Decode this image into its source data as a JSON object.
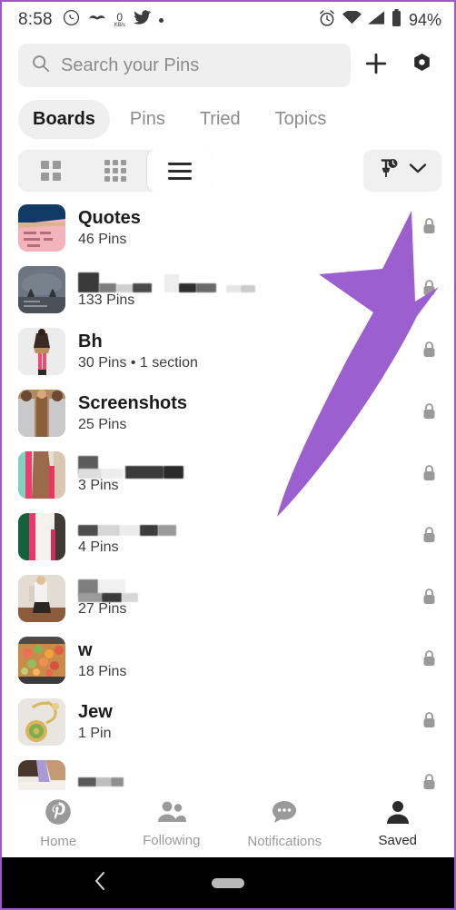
{
  "status_bar": {
    "time": "8:58",
    "left_icons": [
      "whatsapp-icon",
      "mustache-icon",
      "data-speed-icon",
      "twitter-icon",
      "dot-icon"
    ],
    "data_speed_value": "0",
    "data_speed_unit": "KB/s",
    "right_icons": [
      "alarm-clock-icon",
      "wifi-icon",
      "cellular-signal-icon",
      "battery-icon"
    ],
    "battery_percent": "94%"
  },
  "search": {
    "placeholder": "Search your Pins",
    "value": "",
    "icon": "search-icon"
  },
  "header_actions": {
    "add_label": "+",
    "add_icon": "plus-icon",
    "settings_icon": "gear-icon"
  },
  "tabs": [
    {
      "label": "Boards",
      "active": true
    },
    {
      "label": "Pins",
      "active": false
    },
    {
      "label": "Tried",
      "active": false
    },
    {
      "label": "Topics",
      "active": false
    }
  ],
  "view_toggle": [
    {
      "name": "grid-2-view",
      "icon": "grid-2x2-icon",
      "active": false
    },
    {
      "name": "grid-3-view",
      "icon": "grid-3x3-icon",
      "active": false
    },
    {
      "name": "list-view",
      "icon": "list-icon",
      "active": true
    }
  ],
  "sort_button": {
    "name": "sort-boards-button",
    "icons": [
      "pin-icon",
      "clock-icon",
      "chevron-down-icon"
    ]
  },
  "boards": [
    {
      "title": "Quotes",
      "redacted": false,
      "meta": "46 Pins",
      "lock": true,
      "thumb": "quotes"
    },
    {
      "title": "",
      "redacted": true,
      "meta": "133 Pins",
      "lock": true,
      "thumb": "night"
    },
    {
      "title": "Bh",
      "redacted": false,
      "meta": "30 Pins • 1 section",
      "lock": true,
      "thumb": "fashion1"
    },
    {
      "title": "Screenshots",
      "redacted": false,
      "meta": "25 Pins",
      "lock": true,
      "thumb": "fashion2"
    },
    {
      "title": "",
      "redacted": true,
      "meta": "3 Pins",
      "lock": true,
      "thumb": "fashion3"
    },
    {
      "title": "",
      "redacted": true,
      "meta": "4 Pins",
      "lock": true,
      "thumb": "fashion4"
    },
    {
      "title": "",
      "redacted": true,
      "meta": "27 Pins",
      "lock": true,
      "thumb": "fashion5"
    },
    {
      "title": "w",
      "redacted": false,
      "meta": "18 Pins",
      "lock": true,
      "thumb": "food"
    },
    {
      "title": "Jew",
      "redacted": false,
      "meta": "1 Pin",
      "lock": true,
      "thumb": "jewel"
    },
    {
      "title": "",
      "redacted": true,
      "meta": "",
      "lock": true,
      "thumb": "last"
    }
  ],
  "bottom_nav": [
    {
      "label": "Home",
      "icon": "pinterest-icon",
      "active": false
    },
    {
      "label": "Following",
      "icon": "people-icon",
      "active": false
    },
    {
      "label": "Notifications",
      "icon": "chat-bubble-icon",
      "active": false
    },
    {
      "label": "Saved",
      "icon": "person-icon",
      "active": true
    }
  ],
  "android_nav": {
    "back_icon": "back-chevron-icon",
    "home_icon": "home-pill-icon"
  },
  "annotation": {
    "arrow_icon": "callout-arrow-icon",
    "color": "#9b5fd0",
    "points_to": "sort-boards-button"
  },
  "colors": {
    "accent": "#9b5fd0",
    "chip_bg": "#efefef",
    "text_primary": "#1b1b1b",
    "text_secondary": "#8b8b8b"
  }
}
